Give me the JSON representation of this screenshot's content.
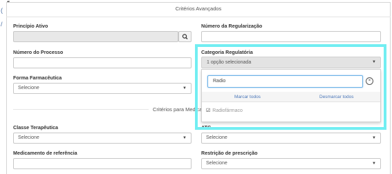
{
  "modal": {
    "title": "Critérios Avançados"
  },
  "fields": {
    "principio_ativo": {
      "label": "Princípio Ativo",
      "value": ""
    },
    "numero_regularizacao": {
      "label": "Número da Regularização",
      "value": ""
    },
    "numero_processo": {
      "label": "Número do Processo",
      "value": ""
    },
    "categoria_regulatoria": {
      "label": "Categoria Regulatória",
      "value": "1 opção selecionada"
    },
    "forma_farmaceutica": {
      "label": "Forma Farmacêutica",
      "value": "Selecione"
    },
    "classe_terapeutica": {
      "label": "Classe Terapêutica",
      "value": "Selecione"
    },
    "atc": {
      "label": "ATC",
      "value": "Selecione"
    },
    "medicamento_referencia": {
      "label": "Medicamento de referência",
      "value": ""
    },
    "restricao_prescricao": {
      "label": "Restrição de prescrição",
      "value": "Selecione"
    }
  },
  "section": {
    "medicamento_title": "Critérios para Medicam"
  },
  "dropdown": {
    "search_value": "Radio",
    "select_all": "Marcar todos",
    "deselect_all": "Desmarcar todos",
    "options": [
      {
        "label": "Radiofármaco",
        "selected": true
      }
    ]
  },
  "colors": {
    "highlight": "#72eef2",
    "link": "#4a76b8"
  },
  "icons": {
    "search": "search-icon",
    "caret": "caret-down-icon",
    "clear": "clear-circle-icon",
    "check": "checkbox-checked-icon"
  }
}
